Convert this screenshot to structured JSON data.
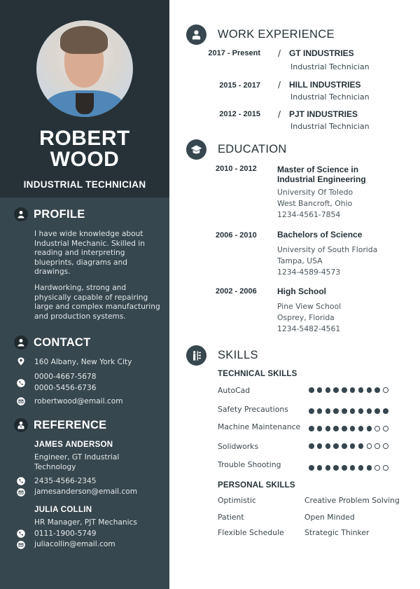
{
  "header": {
    "first_name": "ROBERT",
    "last_name": "WOOD",
    "job_title": "INDUSTRIAL TECHNICIAN"
  },
  "profile": {
    "heading": "PROFILE",
    "paragraphs": [
      "I have wide knowledge about Industrial Mechanic. Skilled in reading and interpreting blueprints, diagrams and drawings.",
      "Hardworking, strong and physically capable of repairing large and complex manufacturing  and production systems."
    ]
  },
  "contact": {
    "heading": "CONTACT",
    "address": "160 Albany, New York City",
    "phones": [
      "0000-4667-5678",
      "0000-5456-6736"
    ],
    "email": "robertwood@email.com"
  },
  "reference": {
    "heading": "REFERENCE",
    "people": [
      {
        "name": "JAMES ANDERSON",
        "role_line1": "Engineer, GT Industrial",
        "role_line2": "Technology",
        "phone": "2435-4566-2345",
        "email": "jamesanderson@email.com"
      },
      {
        "name": "JULIA COLLIN",
        "role_line1": "HR Manager, PJT Mechanics",
        "phone": "0111-1900-5749",
        "email": "juliacollin@email.com"
      }
    ]
  },
  "work": {
    "heading": "WORK EXPERIENCE",
    "jobs": [
      {
        "dates": "2017 - Present",
        "company": "GT INDUSTRIES",
        "role": "Industrial Technician"
      },
      {
        "dates": "2015 - 2017",
        "company": "HILL INDUSTRIES",
        "role": "Industrial Technician"
      },
      {
        "dates": "2012 - 2015",
        "company": "PJT INDUSTRIES",
        "role": "Industrial Technician"
      }
    ],
    "separator": "/"
  },
  "education": {
    "heading": "EDUCATION",
    "entries": [
      {
        "dates": "2010 - 2012",
        "degree": "Master of Science in Industrial Engineering",
        "school": "University Of Toledo",
        "location": "West Bancroft, Ohio",
        "phone": "1234-4561-7854"
      },
      {
        "dates": "2006 - 2010",
        "degree": "Bachelors of Science",
        "school": "University of South Florida",
        "location": "Tampa, USA",
        "phone": "1234-4589-4573"
      },
      {
        "dates": "2002 - 2006",
        "degree": "High School",
        "school": "Pine View School",
        "location": "Osprey, Florida",
        "phone": "1234-5482-4561"
      }
    ]
  },
  "skills": {
    "heading": "SKILLS",
    "technical_heading": "TECHNICAL SKILLS",
    "technical": [
      {
        "name": "AutoCad",
        "rating": 9,
        "max": 10
      },
      {
        "name": "Safety Precautions",
        "rating": 10,
        "max": 10
      },
      {
        "name": "Machine Maintenance",
        "rating": 8,
        "max": 10
      },
      {
        "name": "Solidworks",
        "rating": 7,
        "max": 10
      },
      {
        "name": "Trouble Shooting",
        "rating": 8,
        "max": 10
      }
    ],
    "personal_heading": "PERSONAL SKILLS",
    "personal": [
      "Optimistic",
      "Creative Problem Solving",
      "Patient",
      "Open Minded",
      "Flexible Schedule",
      "Strategic Thinker"
    ]
  },
  "colors": {
    "sidebar_dark": "#263238",
    "sidebar": "#37474f",
    "accent": "#37474f",
    "text_dark": "#263238"
  }
}
